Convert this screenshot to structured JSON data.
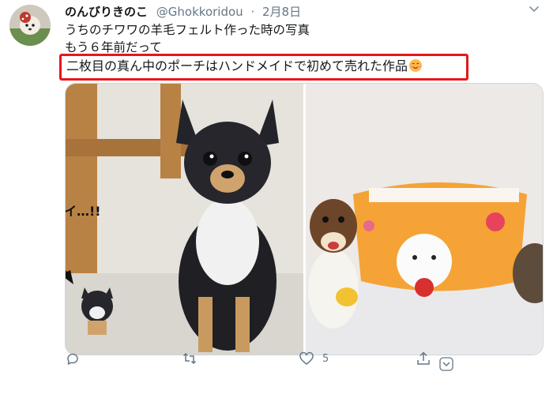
{
  "tweet": {
    "display_name": "のんびりきのこ",
    "handle": "@Ghokkoridou",
    "separator": "·",
    "date": "2月8日",
    "line1": "うちのチワワの羊毛フェルト作った時の写真",
    "line2": "もう６年前だって",
    "line3": "二枚目の真ん中のポーチはハンドメイドで初めて売れた作品",
    "emoji": "smiling-face-emoji"
  },
  "media": {
    "annotation": "カワイイ…!!"
  },
  "actions": {
    "reply_count": "",
    "retweet_count": "",
    "like_count": "5",
    "icons": [
      "reply-icon",
      "retweet-icon",
      "like-icon",
      "share-icon"
    ]
  },
  "colors": {
    "highlight_border": "#e8151a",
    "secondary_text": "#657786",
    "link_blue": "#1da1f2"
  }
}
